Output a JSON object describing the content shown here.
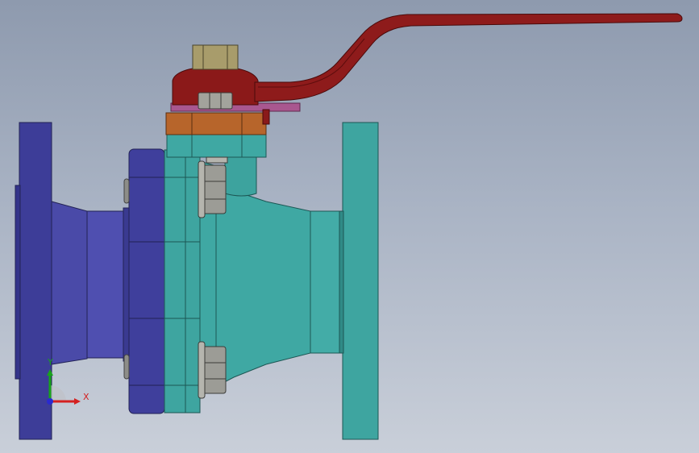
{
  "viewport": {
    "background_top": "#8e9aae",
    "background_bottom": "#c9cfd9"
  },
  "model": {
    "description_icon": "ball-valve-3d-model",
    "colors": {
      "flange_left": "#3f3f9a",
      "flange_left_dark": "#2c2c72",
      "body_teal": "#3fa7a2",
      "body_teal_dark": "#2a7f7b",
      "handle_red": "#8a1a1a",
      "handle_dark": "#5e0d0d",
      "gland_orange": "#b8642a",
      "stem_tan": "#a69a6a",
      "bolt_grey": "#9b9b95",
      "washer_magenta": "#a7568f"
    }
  },
  "triad": {
    "x_label": "X",
    "y_label": "Y",
    "x_color": "#d42020",
    "y_color": "#18a21c",
    "z_color": "#2a2ad0"
  }
}
